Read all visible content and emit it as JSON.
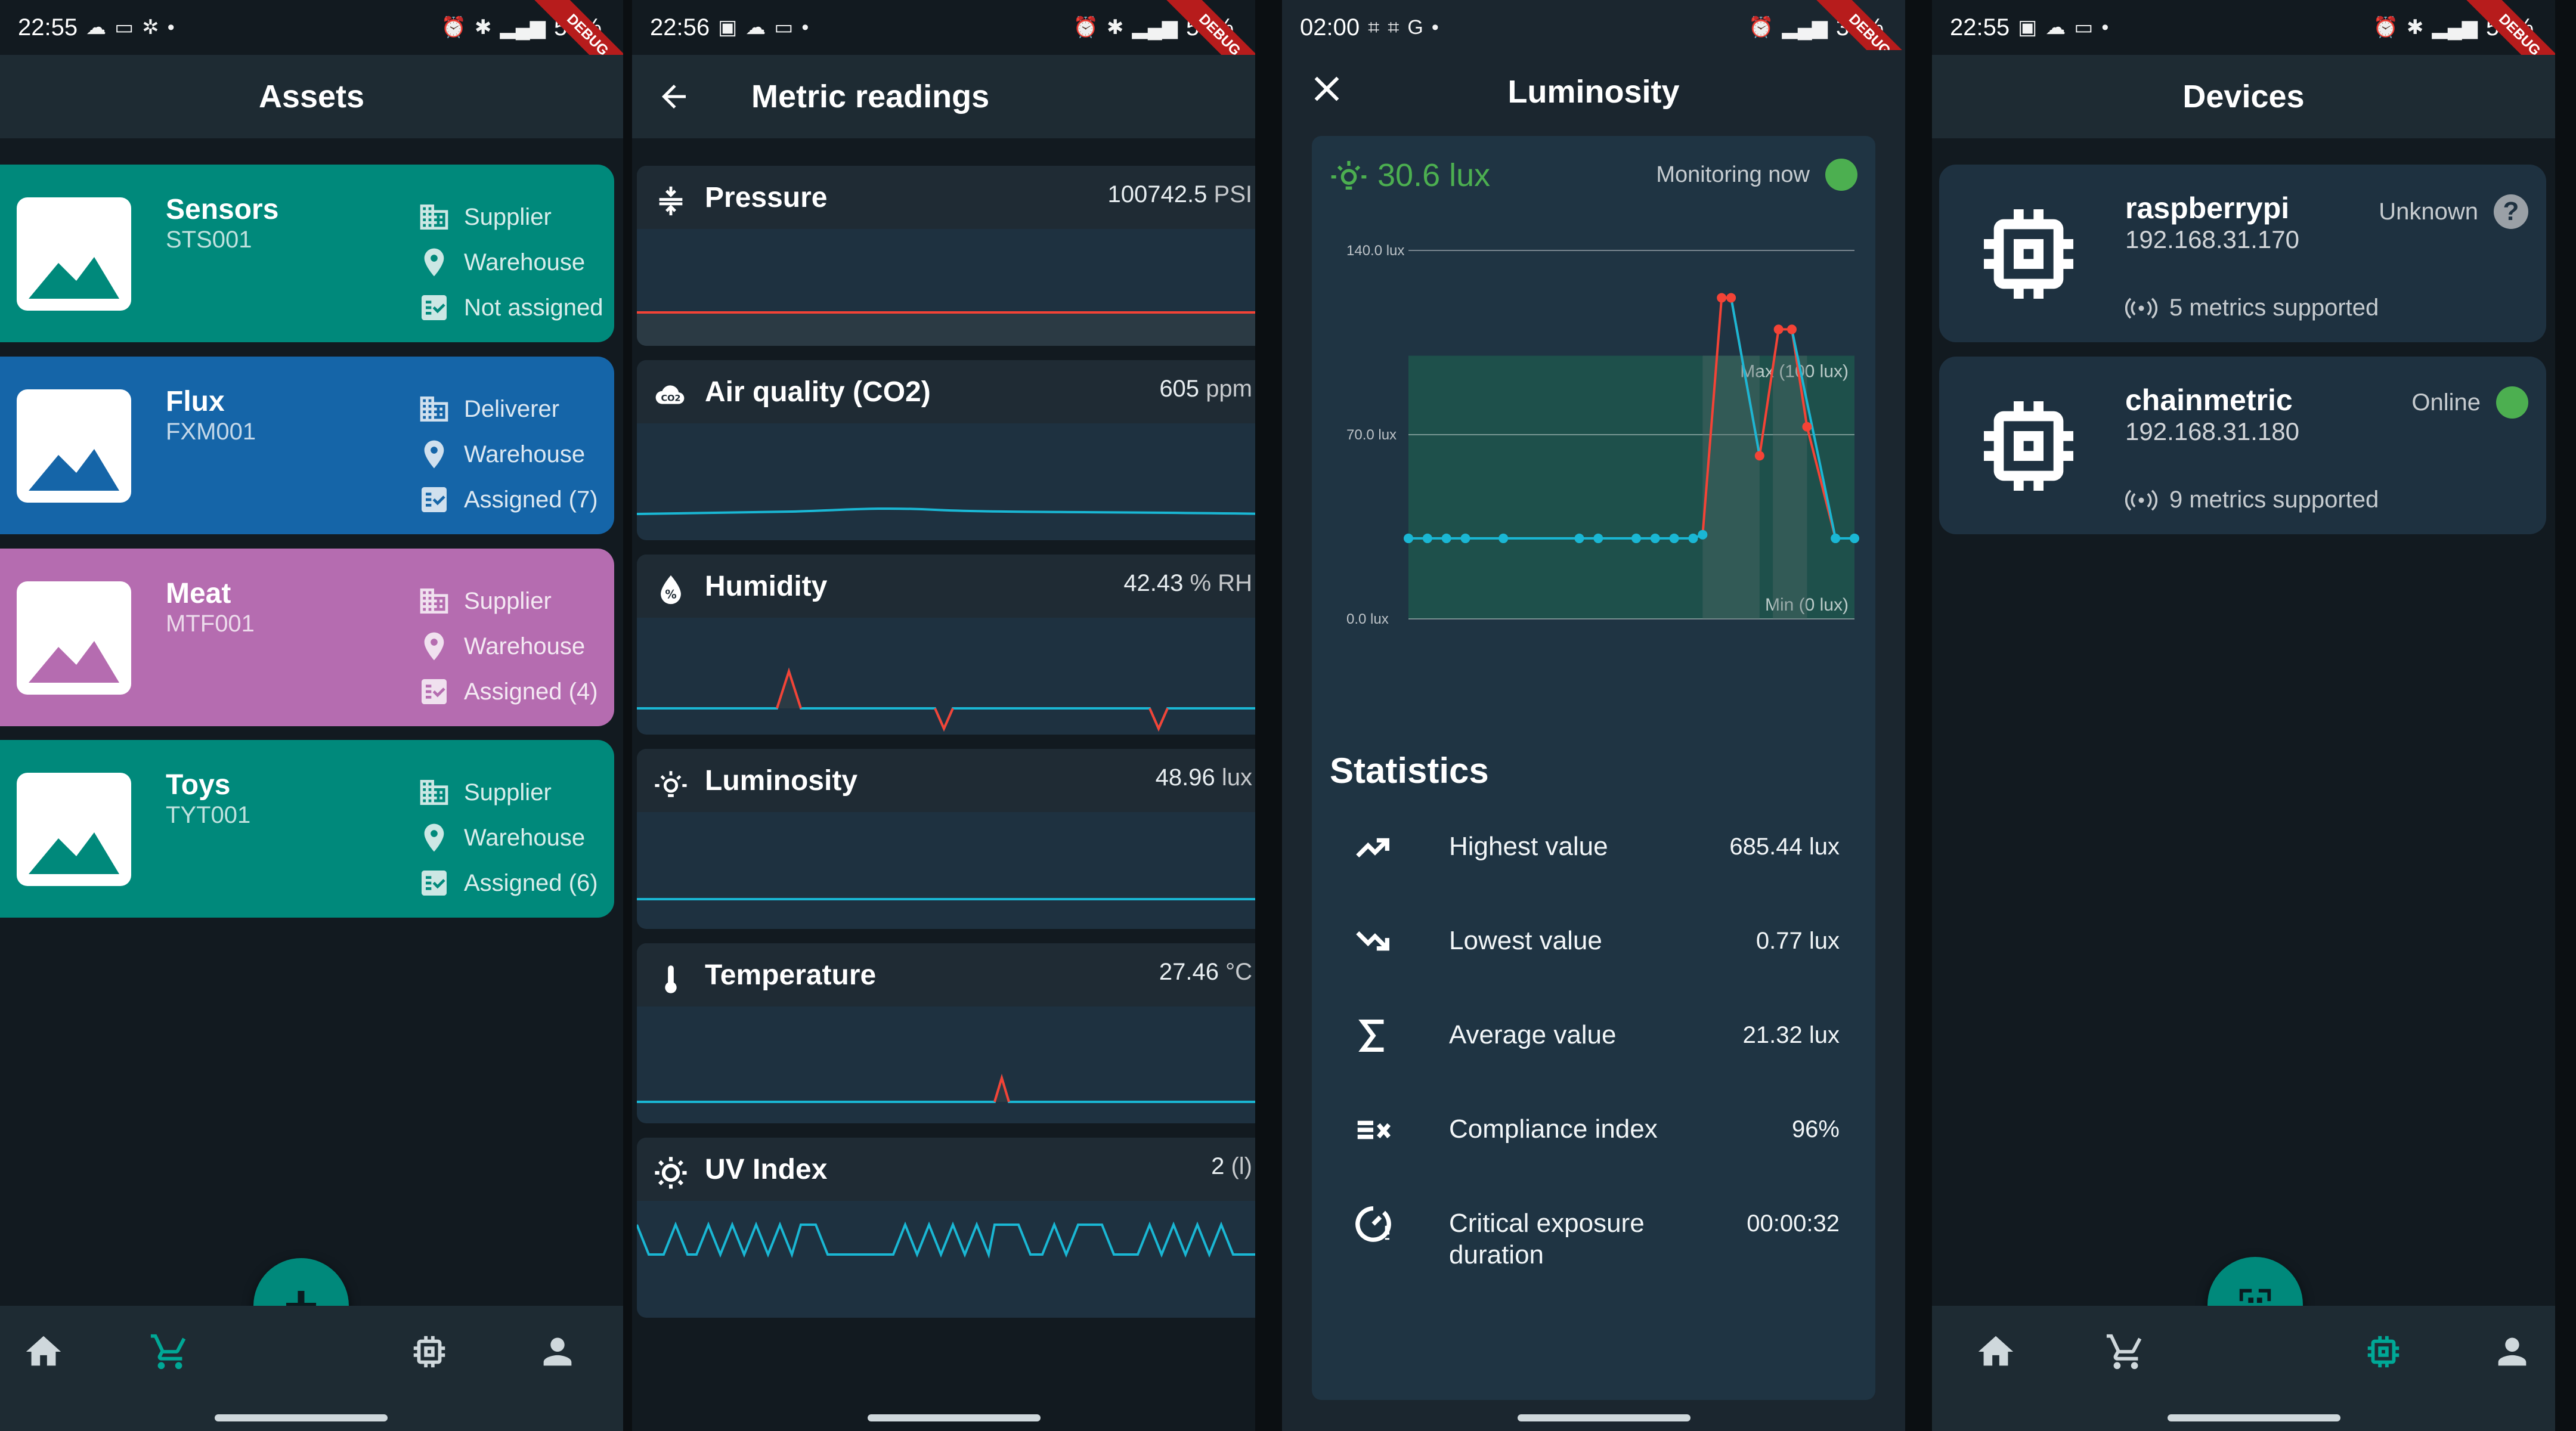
{
  "colors": {
    "teal": "#00897b",
    "blue": "#1565a8",
    "purple": "#b56cb0",
    "accent_cyan": "#1ab7d4",
    "alert_red": "#f44336",
    "green": "#4caf50",
    "nav_active": "#00a896"
  },
  "assets_screen": {
    "status": {
      "time": "22:55",
      "battery": "55%"
    },
    "title": "Assets",
    "ribbon": "DEBUG",
    "cards": [
      {
        "name": "Sensors",
        "code": "STS001",
        "role": "Supplier",
        "location": "Warehouse",
        "assignment": "Not assigned"
      },
      {
        "name": "Flux",
        "code": "FXM001",
        "role": "Deliverer",
        "location": "Warehouse",
        "assignment": "Assigned (7)"
      },
      {
        "name": "Meat",
        "code": "MTF001",
        "role": "Supplier",
        "location": "Warehouse",
        "assignment": "Assigned (4)"
      },
      {
        "name": "Toys",
        "code": "TYT001",
        "role": "Supplier",
        "location": "Warehouse",
        "assignment": "Assigned (6)"
      }
    ],
    "fab_label": "+"
  },
  "metrics_screen": {
    "status": {
      "time": "22:56",
      "battery": "54%"
    },
    "title": "Metric readings",
    "ribbon": "DEBUG",
    "metrics": [
      {
        "name": "Pressure",
        "value": "100742.5",
        "unit": "PSI",
        "icon": "pressure-icon"
      },
      {
        "name": "Air quality (CO2)",
        "value": "605",
        "unit": "ppm",
        "icon": "co2-icon"
      },
      {
        "name": "Humidity",
        "value": "42.43",
        "unit": "% RH",
        "icon": "humidity-icon"
      },
      {
        "name": "Luminosity",
        "value": "48.96",
        "unit": "lux",
        "icon": "luminosity-icon"
      },
      {
        "name": "Temperature",
        "value": "27.46",
        "unit": "°C",
        "icon": "thermometer-icon"
      },
      {
        "name": "UV Index",
        "value": "2",
        "unit": "(l)",
        "icon": "uv-icon"
      }
    ]
  },
  "luminosity_screen": {
    "status": {
      "time": "02:00",
      "battery": "39%"
    },
    "title": "Luminosity",
    "ribbon": "DEBUG",
    "current_value": "30.6 lux",
    "monitoring_label": "Monitoring now",
    "stats_title": "Statistics",
    "stats": [
      {
        "label": "Highest value",
        "value": "685.44 lux",
        "icon": "trending-up-icon"
      },
      {
        "label": "Lowest value",
        "value": "0.77 lux",
        "icon": "trending-down-icon"
      },
      {
        "label": "Average value",
        "value": "21.32 lux",
        "icon": "sigma-icon"
      },
      {
        "label": "Compliance index",
        "value": "96%",
        "icon": "compliance-icon"
      },
      {
        "label": "Critical exposure duration",
        "value": "00:00:32",
        "icon": "timer-alert-icon"
      }
    ]
  },
  "chart_data": {
    "type": "line",
    "title": "",
    "xlabel": "",
    "ylabel": "",
    "ylim": [
      0,
      140
    ],
    "y_ticks": [
      "0.0 lux",
      "70.0 lux",
      "140.0 lux"
    ],
    "band": {
      "min": 0,
      "max": 100,
      "min_label": "Min (0 lux)",
      "max_label": "Max (100 lux)"
    },
    "series": [
      {
        "values": [
          30.6,
          30.6,
          30.6,
          30.6,
          30.6,
          30.6,
          30.6,
          30.6,
          30.6,
          30.6,
          30.6,
          32,
          122,
          122,
          62,
          110,
          110,
          73,
          30.6,
          30.6
        ]
      }
    ],
    "x": [
      0,
      1,
      2,
      3,
      5,
      9,
      10,
      12,
      13,
      14,
      15,
      15.5,
      16.5,
      17,
      18.5,
      19.5,
      20.2,
      21,
      22.5,
      23.5
    ],
    "grid": true
  },
  "devices_screen": {
    "status": {
      "time": "22:55",
      "battery": "55%"
    },
    "title": "Devices",
    "ribbon": "DEBUG",
    "devices": [
      {
        "name": "raspberrypi",
        "ip": "192.168.31.170",
        "metrics": "5 metrics supported",
        "status": "Unknown"
      },
      {
        "name": "chainmetric",
        "ip": "192.168.31.180",
        "metrics": "9 metrics supported",
        "status": "Online"
      }
    ]
  }
}
